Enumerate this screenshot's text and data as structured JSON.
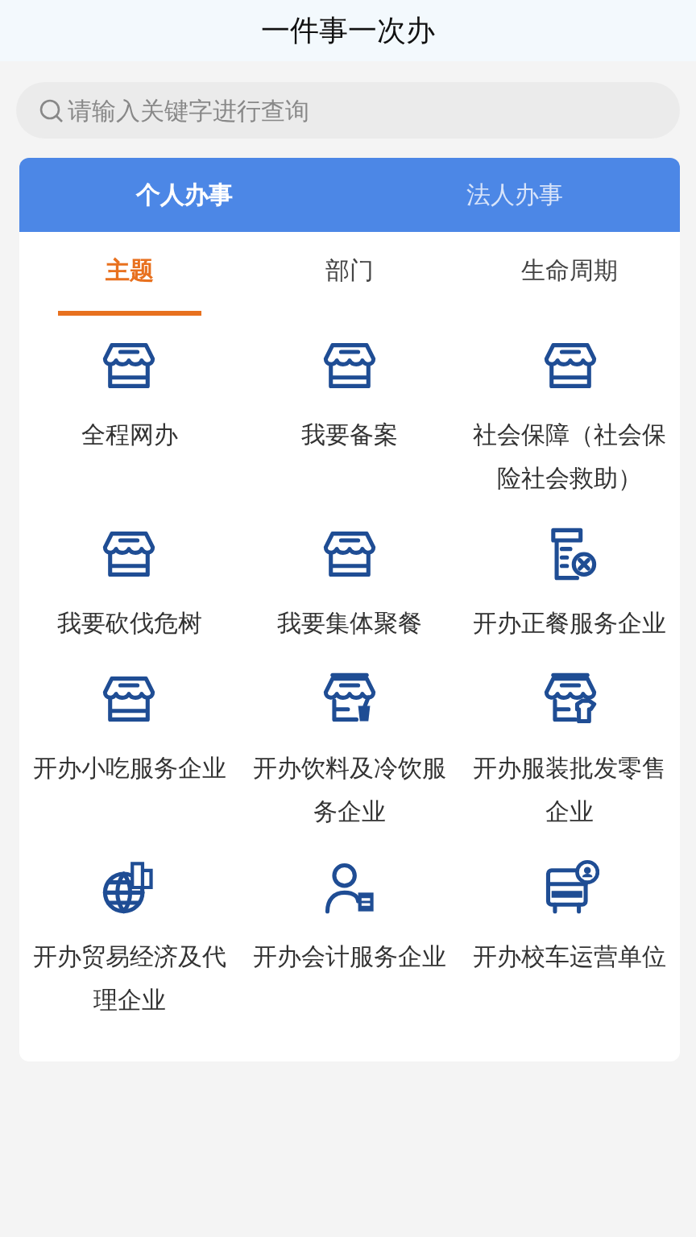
{
  "window": {
    "title": "一件事一次办"
  },
  "search": {
    "placeholder": "请输入关键字进行查询"
  },
  "tabs": [
    {
      "label": "个人办事",
      "selected": true
    },
    {
      "label": "法人办事",
      "selected": false
    }
  ],
  "subtabs": [
    {
      "label": "主题",
      "selected": true
    },
    {
      "label": "部门",
      "selected": false
    },
    {
      "label": "生命周期",
      "selected": false
    }
  ],
  "items": [
    {
      "label": "全程网办",
      "kind": "store"
    },
    {
      "label": "我要备案",
      "kind": "store"
    },
    {
      "label": "社会保障（社会保险社会救助）",
      "kind": "store"
    },
    {
      "label": "我要砍伐危树",
      "kind": "store"
    },
    {
      "label": "我要集体聚餐",
      "kind": "store"
    },
    {
      "label": "开办正餐服务企业",
      "kind": "receipt"
    },
    {
      "label": "开办小吃服务企业",
      "kind": "store"
    },
    {
      "label": "开办饮料及冷饮服务企业",
      "kind": "drink"
    },
    {
      "label": "开办服装批发零售企业",
      "kind": "shirt"
    },
    {
      "label": "开办贸易经济及代理企业",
      "kind": "globe"
    },
    {
      "label": "开办会计服务企业",
      "kind": "person"
    },
    {
      "label": "开办校车运营单位",
      "kind": "bus"
    }
  ]
}
